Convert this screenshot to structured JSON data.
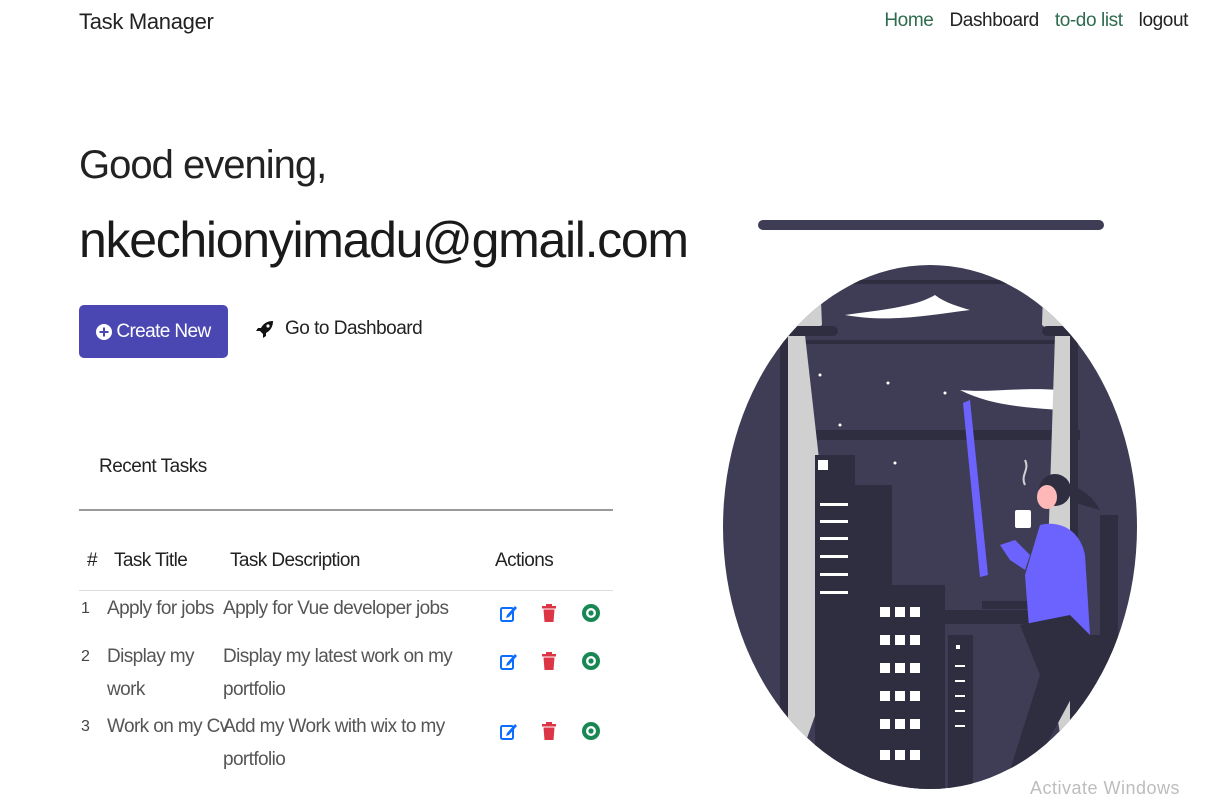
{
  "nav": {
    "brand": "Task Manager",
    "links": [
      "Home",
      "Dashboard",
      "to-do list",
      "logout"
    ]
  },
  "hero": {
    "greeting": "Good evening,",
    "email": "nkechionyimadu@gmail.com"
  },
  "actions": {
    "create_label": "Create New",
    "dashboard_label": "Go to Dashboard"
  },
  "recent": {
    "heading": "Recent Tasks",
    "columns": [
      "#",
      "Task Title",
      "Task Description",
      "Actions"
    ],
    "rows": [
      {
        "num": "1",
        "title": "Apply for jobs",
        "description": "Apply for Vue developer jobs"
      },
      {
        "num": "2",
        "title_lines": [
          "Display my",
          "work"
        ],
        "description_lines": [
          "Display my latest work on my",
          "portfolio"
        ]
      },
      {
        "num": "3",
        "title": "Work on my Cv",
        "description_lines": [
          "Add my Work with wix to my",
          "portfolio"
        ]
      }
    ]
  },
  "icons": {
    "create": "plus-circle-icon",
    "dashboard": "rocket-icon",
    "edit": "edit-icon",
    "delete": "trash-icon",
    "view": "eye-icon"
  },
  "colors": {
    "primary": "#4a47b3",
    "nav_green": "#2f6b4f",
    "edit_blue": "#0d6efd",
    "delete_red": "#dc3545",
    "view_green": "#198754"
  },
  "watermark": "Activate Windows"
}
